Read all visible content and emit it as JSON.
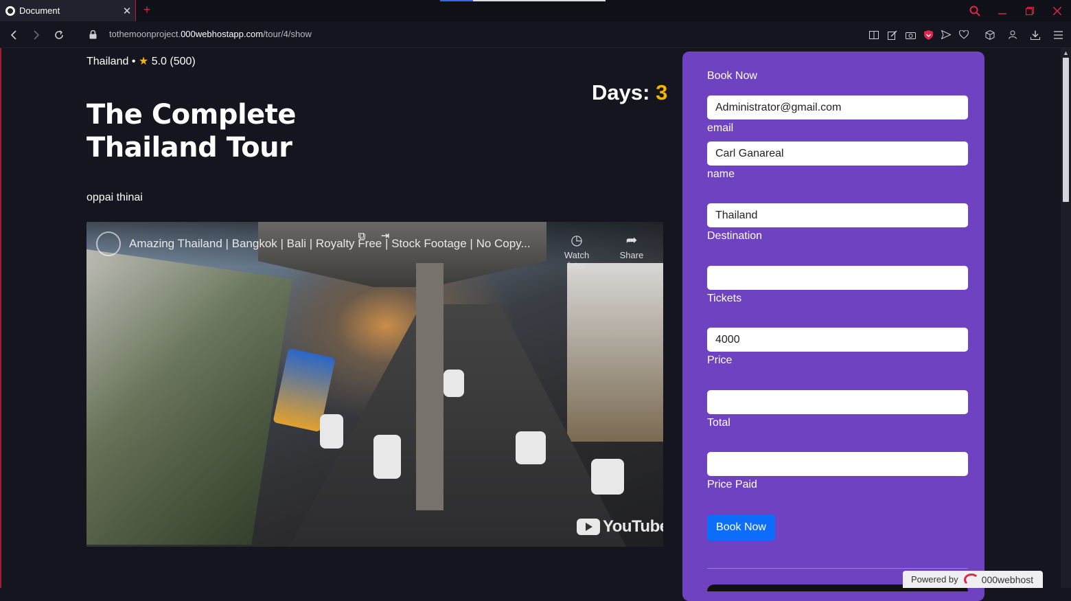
{
  "browser": {
    "tab_title": "Document",
    "tab_close": "✕",
    "new_tab": "+",
    "url_prefix": "tothemoonproject.",
    "url_domain": "000webhostapp.com",
    "url_path": "/tour/4/show",
    "icons": [
      "back-icon",
      "forward-icon",
      "reload-icon",
      "lock-icon",
      "reader-icon",
      "edit-icon",
      "camera-icon",
      "shield-icon",
      "send-icon",
      "heart-icon",
      "cube-icon",
      "profile-icon",
      "download-icon",
      "menu-icon"
    ]
  },
  "tour": {
    "location": "Thailand",
    "bullet": "•",
    "star": "★",
    "rating": "5.0",
    "reviews": "(500)",
    "title": "The Complete Thailand Tour",
    "days_label": "Days:",
    "days_value": "3",
    "description": "oppai thinai"
  },
  "video": {
    "title": "Amazing Thailand | Bangkok | Bali | Royalty Free | Stock Footage | No Copy...",
    "watch_later": "Watch later",
    "share": "Share",
    "brand": "YouTube"
  },
  "booking": {
    "heading": "Book Now",
    "fields": [
      {
        "value": "Administrator@gmail.com",
        "label": "email"
      },
      {
        "value": "Carl Ganareal",
        "label": "name"
      },
      {
        "value": "Thailand",
        "label": "Destination"
      },
      {
        "value": "",
        "label": "Tickets"
      },
      {
        "value": "4000",
        "label": "Price"
      },
      {
        "value": "",
        "label": "Total"
      },
      {
        "value": "",
        "label": "Price Paid"
      }
    ],
    "submit": "Book Now"
  },
  "footer": {
    "powered_by": "Powered by",
    "host_brand": "000webhost"
  },
  "colors": {
    "panel": "#6f42c1",
    "accent_yellow": "#f4b400",
    "button_blue": "#0d6efd",
    "browser_red": "#e0264a"
  }
}
